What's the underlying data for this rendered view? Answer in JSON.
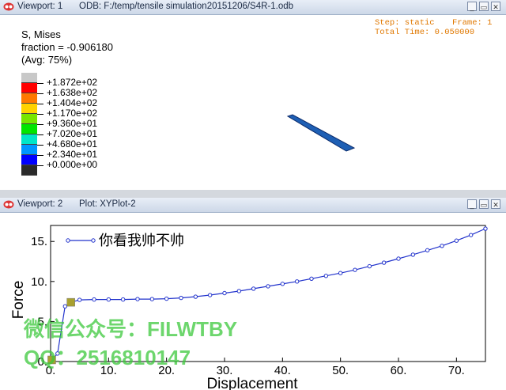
{
  "viewport1": {
    "title": "Viewport: 1",
    "odb": "ODB: F:/temp/tensile simulation20151206/S4R-1.odb",
    "field": "S, Mises",
    "fraction": "fraction = -0.906180",
    "avg": "(Avg: 75%)",
    "step": "Step: static",
    "frame": "Frame: 1",
    "total_time": "Total Time: 0.050000",
    "colorbar": {
      "labels": [
        "+1.872e+02",
        "+1.638e+02",
        "+1.404e+02",
        "+1.170e+02",
        "+9.360e+01",
        "+7.020e+01",
        "+4.680e+01",
        "+2.340e+01",
        "+0.000e+00"
      ],
      "colors": [
        "#c8c8c8",
        "#ff0000",
        "#ff7800",
        "#ffd200",
        "#78e600",
        "#00e600",
        "#00e6c8",
        "#0096ff",
        "#0000ff",
        "#2a2a2a"
      ]
    },
    "part_color": "#1e5fb4"
  },
  "viewport2": {
    "title": "Viewport: 2",
    "plot": "Plot: XYPlot-2"
  },
  "chart_data": {
    "type": "line",
    "title": "",
    "xlabel": "Displacement",
    "ylabel": "Force",
    "xlim": [
      0,
      75
    ],
    "ylim": [
      0,
      17
    ],
    "xticks": [
      "0.",
      "10.",
      "20.",
      "30.",
      "40.",
      "50.",
      "60.",
      "70."
    ],
    "yticks": [
      "0.",
      "5.",
      "10.",
      "15."
    ],
    "series": [
      {
        "name": "你看我帅不帅",
        "color": "#2233cc",
        "x": [
          0,
          1.2,
          2.5,
          3.5,
          5,
          7.5,
          10,
          12.5,
          15,
          17.5,
          20,
          22.5,
          25,
          27.5,
          30,
          32.5,
          35,
          37.5,
          40,
          42.5,
          45,
          47.5,
          50,
          52.5,
          55,
          57.5,
          60,
          62.5,
          65,
          67.5,
          70,
          72.5,
          75
        ],
        "y": [
          0,
          1.0,
          6.9,
          7.4,
          7.7,
          7.75,
          7.75,
          7.75,
          7.8,
          7.8,
          7.85,
          7.95,
          8.1,
          8.3,
          8.55,
          8.8,
          9.1,
          9.4,
          9.7,
          10.0,
          10.35,
          10.7,
          11.05,
          11.45,
          11.9,
          12.35,
          12.85,
          13.35,
          13.9,
          14.45,
          15.1,
          15.8,
          16.6
        ]
      }
    ],
    "markers": [
      {
        "x": 3.5,
        "y": 7.4,
        "color": "#a8a030"
      },
      {
        "x": 0.2,
        "y": 0.2,
        "color": "#a8a030"
      }
    ],
    "legend": "top-left",
    "grid": false
  },
  "watermark": {
    "line1": "微信公众号：FILWTBY",
    "line2": "QQ：2516810147"
  },
  "buttons": {
    "minimize": "_",
    "restore": "▭",
    "close": "✕"
  }
}
